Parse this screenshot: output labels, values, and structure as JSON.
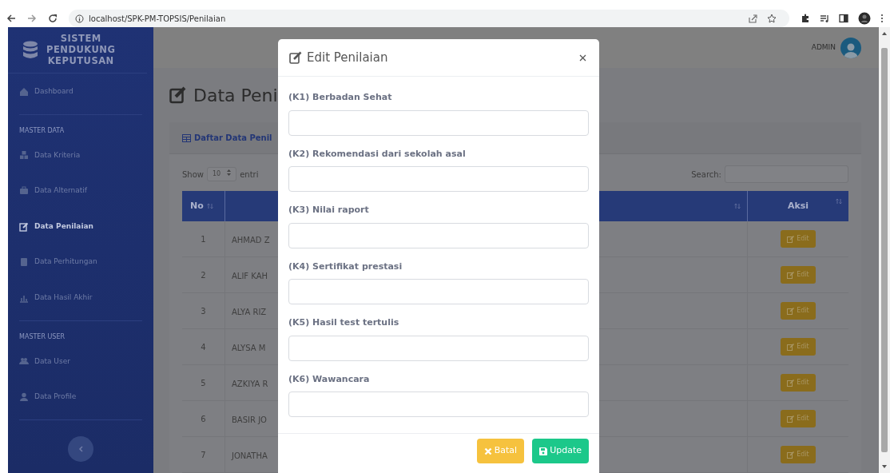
{
  "browser": {
    "url": "localhost/SPK-PM-TOPSIS/Penilaian"
  },
  "sidebar": {
    "brand_lines": [
      "SISTEM",
      "PENDUKUNG",
      "KEPUTUSAN"
    ],
    "items": [
      {
        "kind": "link",
        "label": "Dashboard",
        "selected": false
      },
      {
        "kind": "heading",
        "label": "MASTER DATA"
      },
      {
        "kind": "link",
        "label": "Data Kriteria",
        "selected": false
      },
      {
        "kind": "link",
        "label": "Data Alternatif",
        "selected": false
      },
      {
        "kind": "link",
        "label": "Data Penilaian",
        "selected": true
      },
      {
        "kind": "link",
        "label": "Data Perhitungan",
        "selected": false
      },
      {
        "kind": "link",
        "label": "Data Hasil Akhir",
        "selected": false
      },
      {
        "kind": "heading",
        "label": "MASTER USER"
      },
      {
        "kind": "link",
        "label": "Data User",
        "selected": false
      },
      {
        "kind": "link",
        "label": "Data Profile",
        "selected": false
      }
    ]
  },
  "topbar": {
    "user": "ADMIN"
  },
  "page": {
    "title": "Data Peni",
    "card_title": "Daftar Data Penil",
    "show_label": "Show",
    "page_size": "10",
    "entries_label": "entri",
    "search_label": "Search:",
    "columns": [
      "No",
      "Aksi"
    ],
    "rows": [
      {
        "no": "1",
        "name": "AHMAD Z",
        "action": "Edit"
      },
      {
        "no": "2",
        "name": "ALIF KAH",
        "action": "Edit"
      },
      {
        "no": "3",
        "name": "ALYA RIZ",
        "action": "Edit"
      },
      {
        "no": "4",
        "name": "ALYSA M",
        "action": "Edit"
      },
      {
        "no": "5",
        "name": "AZKIYA R",
        "action": "Edit"
      },
      {
        "no": "6",
        "name": "BASIR JO",
        "action": "Edit"
      },
      {
        "no": "7",
        "name": "JONATHA",
        "action": "Edit"
      }
    ]
  },
  "modal": {
    "title": "Edit Penilaian",
    "fields": [
      {
        "label": "(K1) Berbadan Sehat"
      },
      {
        "label": "(K2) Rekomendasi dari sekolah asal"
      },
      {
        "label": "(K3) Nilai raport"
      },
      {
        "label": "(K4) Sertifikat prestasi"
      },
      {
        "label": "(K5) Hasil test tertulis"
      },
      {
        "label": "(K6) Wawancara"
      }
    ],
    "buttons": [
      {
        "kind": "cancel",
        "label": "Batal"
      },
      {
        "kind": "submit",
        "label": "Update"
      }
    ]
  }
}
